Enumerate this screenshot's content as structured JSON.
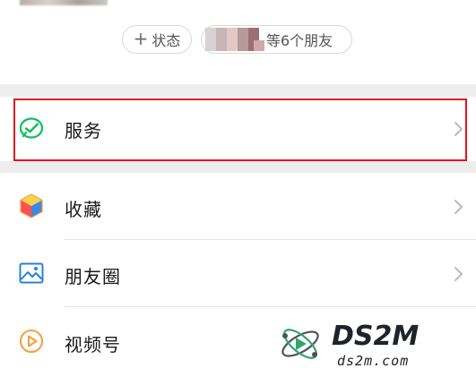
{
  "status_bar": {
    "add_status_label": "状态",
    "friends_label": "等6个朋友"
  },
  "menu": {
    "items": [
      {
        "label": "服务",
        "icon": "services-check-icon"
      },
      {
        "label": "收藏",
        "icon": "favorites-cube-icon"
      },
      {
        "label": "朋友圈",
        "icon": "moments-image-icon"
      },
      {
        "label": "视频号",
        "icon": "channels-play-icon"
      }
    ]
  },
  "watermark": {
    "brand": "DS2M",
    "domain": "ds2m.com"
  },
  "colors": {
    "highlight": "#e8141c",
    "separator": "#ededed",
    "services_green": "#07c160",
    "favorites_orange": "#fa9d3b",
    "moments_blue": "#2782d7",
    "channels_orange": "#fa9d3b"
  }
}
